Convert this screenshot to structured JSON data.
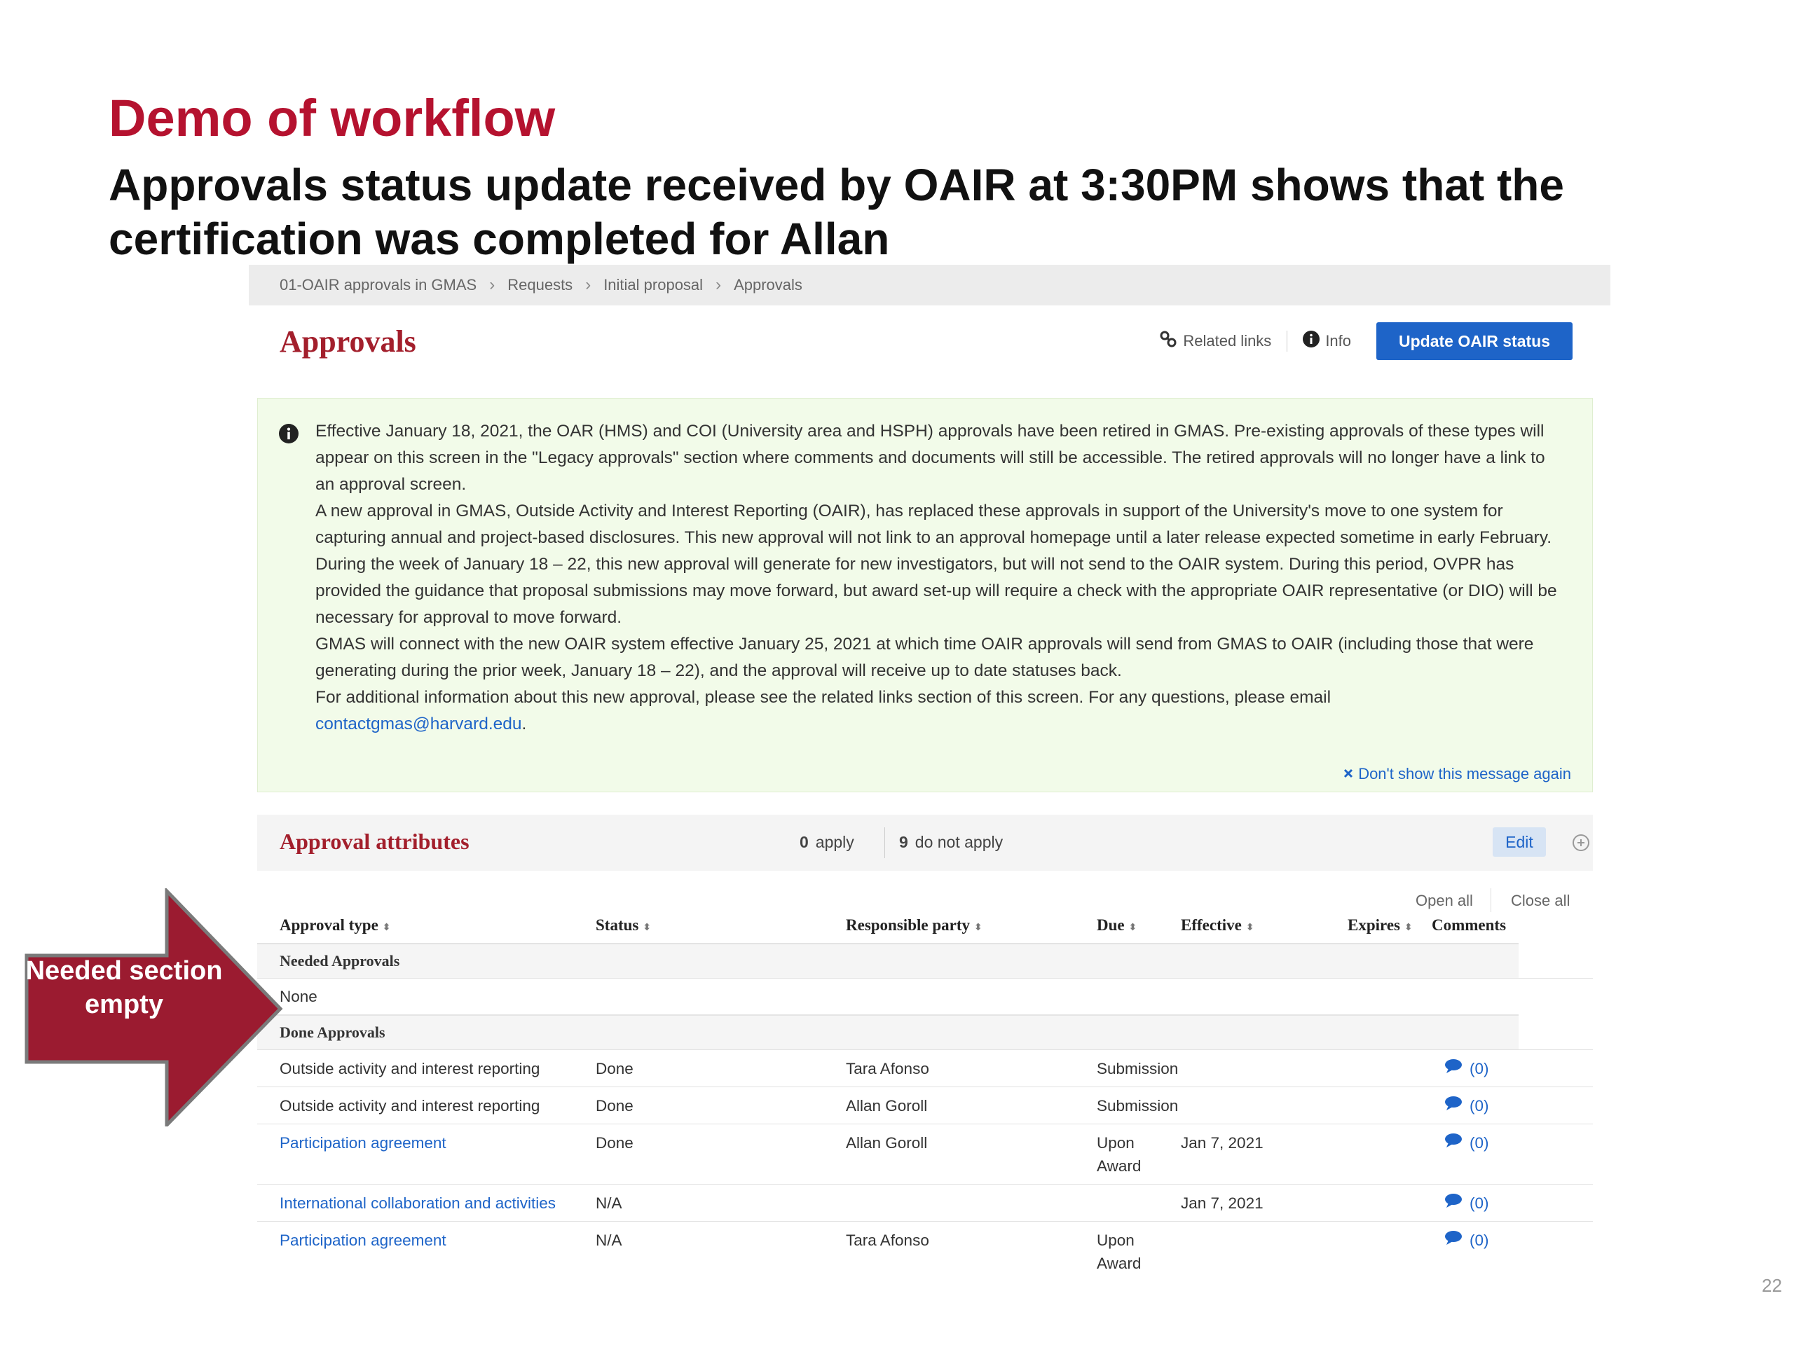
{
  "slide": {
    "title": "Demo of workflow",
    "subtitle": "Approvals status update received by OAIR at 3:30PM shows that the certification was completed for Allan",
    "page_number": "22",
    "callout_text": "Needed section empty"
  },
  "breadcrumb": [
    "01-OAIR approvals in GMAS",
    "Requests",
    "Initial proposal",
    "Approvals"
  ],
  "header": {
    "title": "Approvals",
    "related_links": "Related links",
    "info": "Info",
    "update_button": "Update OAIR status"
  },
  "notice": {
    "lines": [
      "Effective January 18, 2021, the OAR (HMS) and COI (University area and HSPH) approvals have been retired in GMAS. Pre-existing approvals of these types will appear on this screen in the \"Legacy approvals\" section where comments and documents will still be accessible. The retired approvals will no longer have a link to an approval screen.",
      "A new approval in GMAS, Outside Activity and Interest Reporting (OAIR), has replaced these approvals in support of the University's move to one system for capturing annual and project-based disclosures. This new approval will not link to an approval homepage until a later release expected sometime in early February.",
      "During the week of January 18 – 22, this new approval will generate for new investigators, but will not send to the OAIR system. During this period, OVPR has provided the guidance that proposal submissions may move forward, but award set-up will require a check with the appropriate OAIR representative (or DIO) will be necessary for approval to move forward.",
      "GMAS will connect with the new OAIR system effective January 25, 2021 at which time OAIR approvals will send from GMAS to OAIR (including those that were generating during the prior week, January 18 – 22), and the approval will receive up to date statuses back.",
      "For additional information about this new approval, please see the related links section of this screen. For any questions, please email"
    ],
    "email": "contactgmas@harvard.edu",
    "email_suffix": ".",
    "dismiss": "Don't show this message again"
  },
  "attributes": {
    "title": "Approval attributes",
    "apply_count": "0",
    "apply_label": "apply",
    "not_apply_count": "9",
    "not_apply_label": "do not apply",
    "edit": "Edit"
  },
  "table": {
    "open_all": "Open all",
    "close_all": "Close all",
    "columns": {
      "type": "Approval type",
      "status": "Status",
      "party": "Responsible party",
      "due": "Due",
      "effective": "Effective",
      "expires": "Expires",
      "comments": "Comments"
    },
    "needed_group": "Needed Approvals",
    "needed_empty": "None",
    "done_group": "Done Approvals",
    "rows": [
      {
        "type": "Outside activity and interest reporting",
        "status": "Done",
        "party": "Tara Afonso",
        "due": "Submission",
        "effective": "",
        "comments": "(0)"
      },
      {
        "type": "Outside activity and interest reporting",
        "status": "Done",
        "party": "Allan Goroll",
        "due": "Submission",
        "effective": "",
        "comments": "(0)"
      },
      {
        "type": "Participation agreement",
        "status": "Done",
        "party": "Allan Goroll",
        "due": "Upon Award",
        "effective": "Jan 7, 2021",
        "comments": "(0)"
      },
      {
        "type": "International collaboration and activities",
        "status": "N/A",
        "party": "",
        "due": "",
        "effective": "Jan 7, 2021",
        "comments": "(0)"
      },
      {
        "type": "Participation agreement",
        "status": "N/A",
        "party": "Tara Afonso",
        "due": "Upon Award",
        "effective": "",
        "comments": "(0)"
      }
    ]
  },
  "colors": {
    "title_red": "#b5122f",
    "brand_red": "#a31f2c",
    "link_blue": "#1e64c8",
    "notice_bg": "#f2fbe9",
    "callout_red": "#9b1b30"
  }
}
